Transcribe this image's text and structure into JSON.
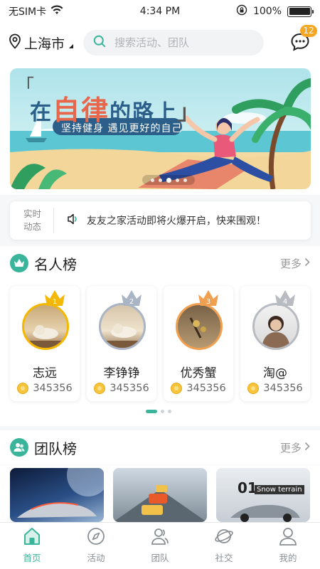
{
  "status_bar": {
    "carrier": "无SIM卡",
    "time": "4:34 PM",
    "battery": "100%"
  },
  "header": {
    "city": "上海市",
    "search_placeholder": "搜索活动、团队",
    "message_badge": "12"
  },
  "banner": {
    "headline_prefix": "在",
    "headline_highlight": "自律",
    "headline_suffix": "的路上",
    "subtitle": "坚持健身 遇见更好的自己",
    "slide_count": 5,
    "active_slide": 3
  },
  "news": {
    "tag_line1": "实时",
    "tag_line2": "动态",
    "text": "友友之家活动即将火爆开启，快来围观！"
  },
  "celebrity": {
    "title": "名人榜",
    "more": "更多",
    "cards": [
      {
        "rank": "1",
        "name": "志远",
        "score": "345356"
      },
      {
        "rank": "2",
        "name": "李铮铮",
        "score": "345356"
      },
      {
        "rank": "3",
        "name": "优秀蟹",
        "score": "345356"
      },
      {
        "rank": "4",
        "name": "淘@",
        "score": "345356"
      }
    ],
    "page_count": 3,
    "active_page": 1
  },
  "team": {
    "title": "团队榜",
    "more": "更多",
    "thumb_texts": [
      "01",
      "Snow terrain"
    ]
  },
  "tabbar": {
    "items": [
      {
        "label": "首页",
        "active": true
      },
      {
        "label": "活动",
        "active": false
      },
      {
        "label": "团队",
        "active": false
      },
      {
        "label": "社交",
        "active": false
      },
      {
        "label": "我的",
        "active": false
      }
    ]
  },
  "colors": {
    "accent": "#3ab59b",
    "badge": "#f5a623",
    "gold": "#f5b800",
    "silver": "#a9b4c4",
    "bronze": "#f0a050"
  }
}
